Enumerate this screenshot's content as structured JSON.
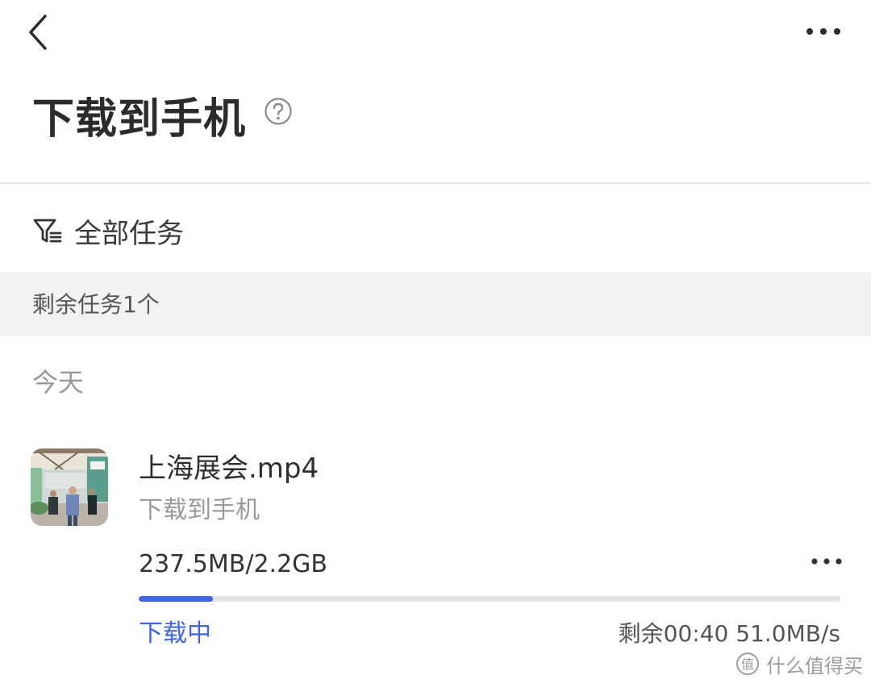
{
  "header": {
    "title": "下载到手机"
  },
  "filter": {
    "label": "全部任务"
  },
  "section": {
    "remaining_tasks": "剩余任务1个"
  },
  "group": {
    "date_label": "今天"
  },
  "download_item": {
    "filename": "上海展会.mp4",
    "destination": "下载到手机",
    "size_progress": "237.5MB/2.2GB",
    "progress_fraction": 0.106,
    "status": "下载中",
    "remaining_speed": "剩余00:40 51.0MB/s"
  },
  "watermark": {
    "text": "什么值得买"
  },
  "colors": {
    "accent": "#3d63f0",
    "section_bg": "#f2f2f2",
    "track": "#e3e3e3"
  },
  "icons": [
    "back-arrow-icon",
    "more-dots-icon",
    "help-icon",
    "filter-icon",
    "video-thumbnail",
    "watermark-logo-icon"
  ]
}
